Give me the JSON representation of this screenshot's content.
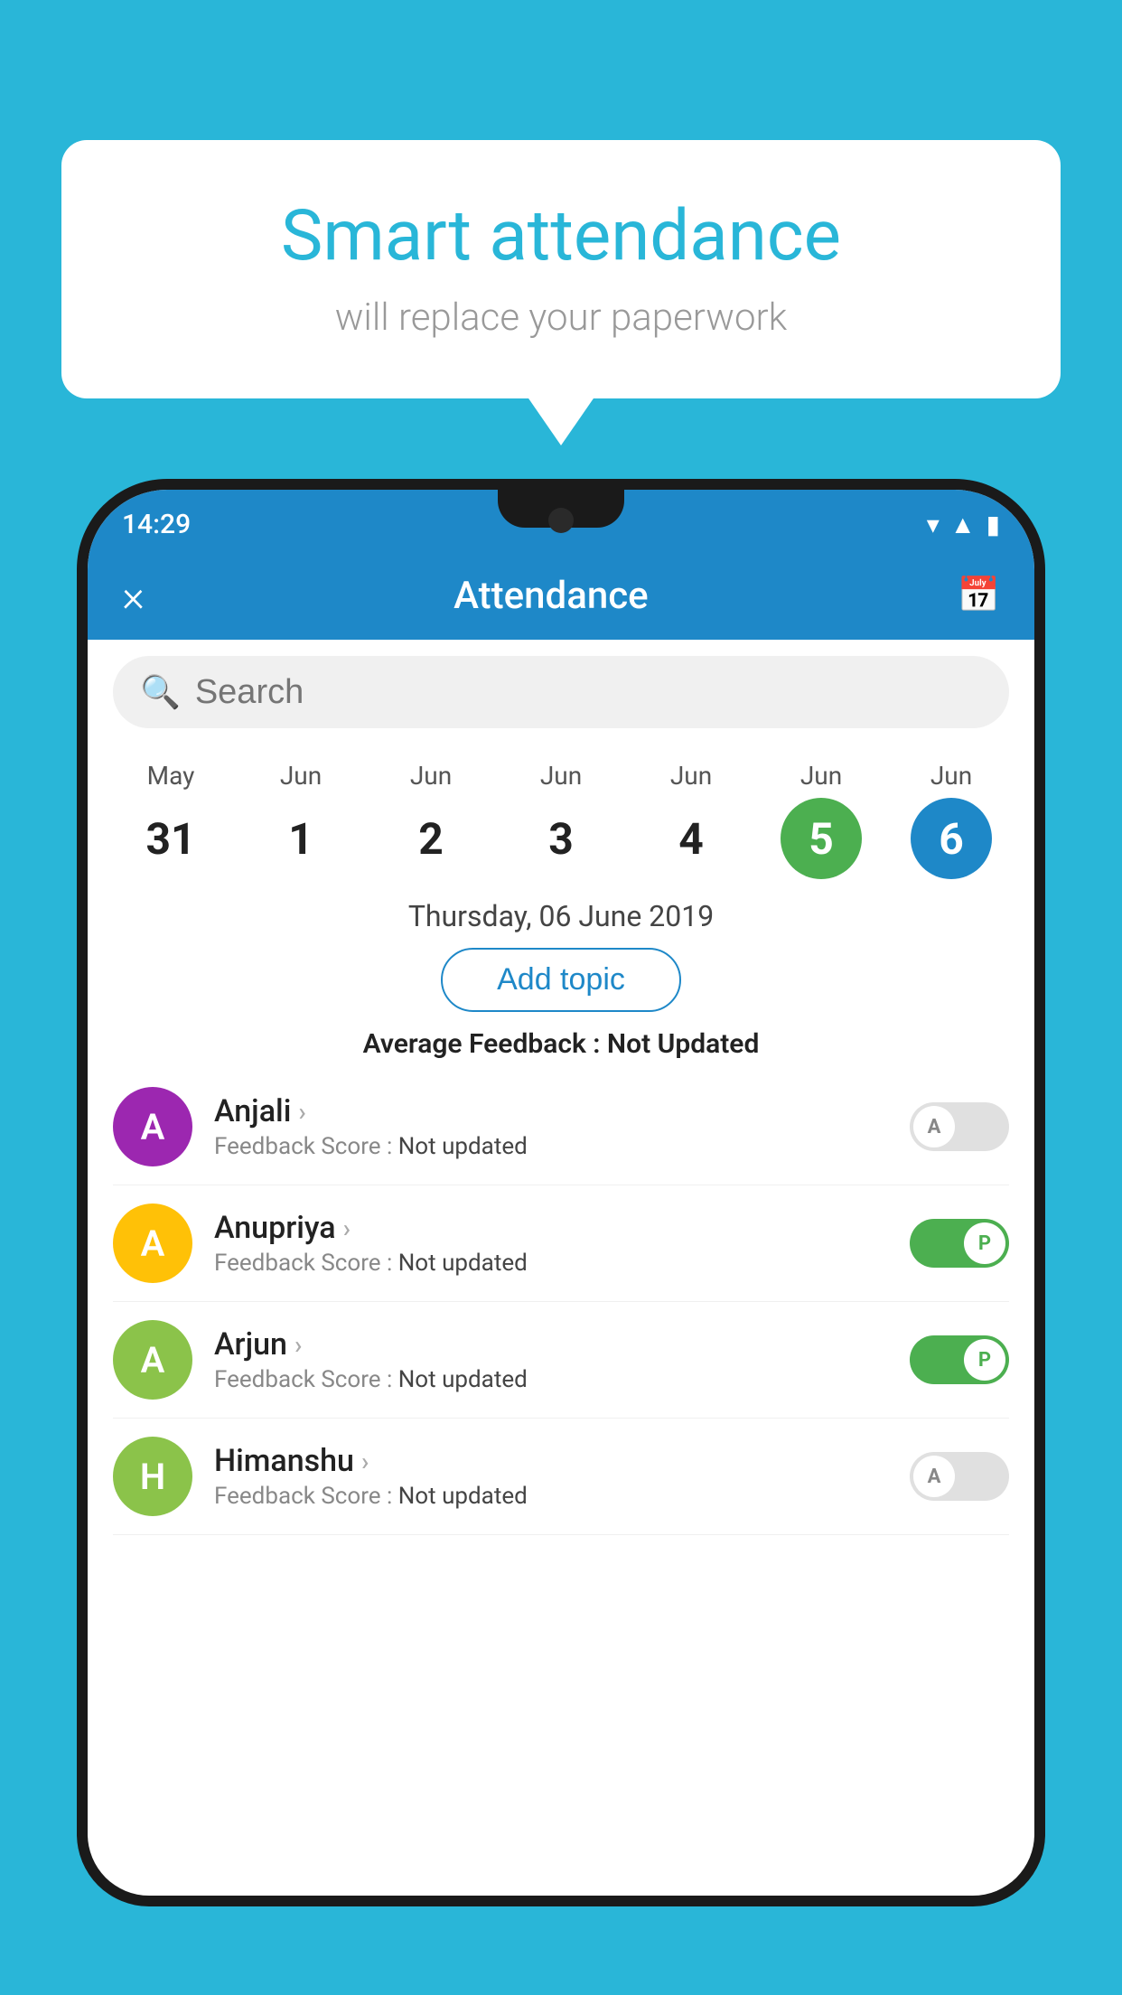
{
  "background": "#29b6d8",
  "bubble": {
    "title": "Smart attendance",
    "subtitle": "will replace your paperwork"
  },
  "statusBar": {
    "time": "14:29",
    "icons": [
      "wifi",
      "signal",
      "battery"
    ]
  },
  "header": {
    "title": "Attendance",
    "closeLabel": "×",
    "calendarIcon": "📅"
  },
  "search": {
    "placeholder": "Search"
  },
  "calendar": {
    "dates": [
      {
        "month": "May",
        "day": "31",
        "state": "normal"
      },
      {
        "month": "Jun",
        "day": "1",
        "state": "normal"
      },
      {
        "month": "Jun",
        "day": "2",
        "state": "normal"
      },
      {
        "month": "Jun",
        "day": "3",
        "state": "normal"
      },
      {
        "month": "Jun",
        "day": "4",
        "state": "normal"
      },
      {
        "month": "Jun",
        "day": "5",
        "state": "today"
      },
      {
        "month": "Jun",
        "day": "6",
        "state": "selected"
      }
    ]
  },
  "selectedDate": "Thursday, 06 June 2019",
  "addTopic": "Add topic",
  "avgFeedback": {
    "label": "Average Feedback : ",
    "value": "Not Updated"
  },
  "students": [
    {
      "name": "Anjali",
      "avatarLetter": "A",
      "avatarColor": "#9c27b0",
      "feedbackLabel": "Feedback Score : ",
      "feedbackValue": "Not updated",
      "attendance": "absent",
      "toggleLabel": "A"
    },
    {
      "name": "Anupriya",
      "avatarLetter": "A",
      "avatarColor": "#ffc107",
      "feedbackLabel": "Feedback Score : ",
      "feedbackValue": "Not updated",
      "attendance": "present",
      "toggleLabel": "P"
    },
    {
      "name": "Arjun",
      "avatarLetter": "A",
      "avatarColor": "#8bc34a",
      "feedbackLabel": "Feedback Score : ",
      "feedbackValue": "Not updated",
      "attendance": "present",
      "toggleLabel": "P"
    },
    {
      "name": "Himanshu",
      "avatarLetter": "H",
      "avatarColor": "#8bc34a",
      "feedbackLabel": "Feedback Score : ",
      "feedbackValue": "Not updated",
      "attendance": "absent",
      "toggleLabel": "A"
    }
  ]
}
